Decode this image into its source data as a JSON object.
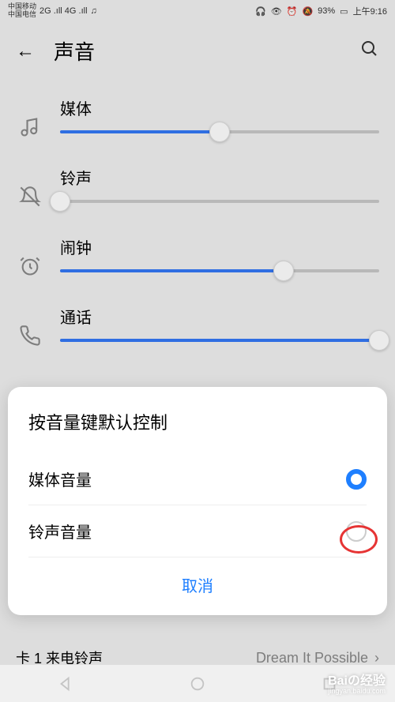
{
  "status": {
    "carrier1": "中国移动",
    "carrier2": "中国电信",
    "signal": "2G .ıll 4G .ıll",
    "music": "♫",
    "battery": "93%",
    "time": "上午9:16"
  },
  "header": {
    "title": "声音"
  },
  "sliders": [
    {
      "label": "媒体",
      "value": 50,
      "icon": "music-note"
    },
    {
      "label": "铃声",
      "value": 0,
      "icon": "bell-off"
    },
    {
      "label": "闹钟",
      "value": 70,
      "icon": "alarm"
    },
    {
      "label": "通话",
      "value": 100,
      "icon": "phone"
    }
  ],
  "dialog": {
    "title": "按音量键默认控制",
    "options": [
      {
        "label": "媒体音量",
        "selected": true
      },
      {
        "label": "铃声音量",
        "selected": false
      }
    ],
    "cancel": "取消"
  },
  "ringtone_row": {
    "label": "卡 1 来电铃声",
    "value": "Dream It Possible"
  },
  "watermark": {
    "main": "Baiの经验",
    "sub": "jingyan.baidu.com"
  }
}
